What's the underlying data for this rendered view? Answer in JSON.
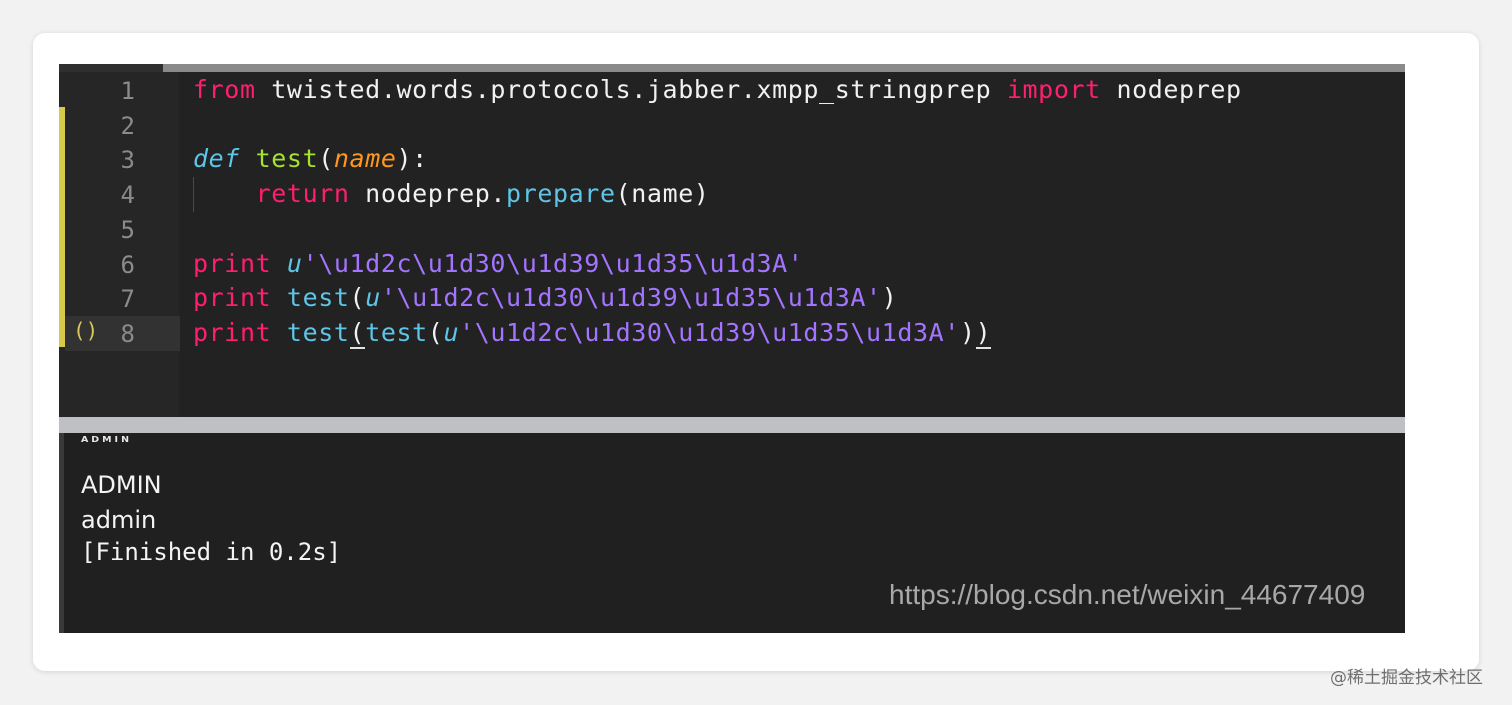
{
  "editor": {
    "lines": [
      {
        "number": "1",
        "tokens": [
          {
            "t": "from",
            "c": "kw"
          },
          {
            "t": " twisted.words.protocols.jabber.xmpp_stringprep ",
            "c": "plain"
          },
          {
            "t": "import",
            "c": "kw"
          },
          {
            "t": " nodeprep",
            "c": "plain"
          }
        ]
      },
      {
        "number": "2",
        "tokens": []
      },
      {
        "number": "3",
        "tokens": [
          {
            "t": "def",
            "c": "def"
          },
          {
            "t": " ",
            "c": "plain"
          },
          {
            "t": "test",
            "c": "fn"
          },
          {
            "t": "(",
            "c": "plain"
          },
          {
            "t": "name",
            "c": "param"
          },
          {
            "t": "):",
            "c": "plain"
          }
        ]
      },
      {
        "number": "4",
        "tokens": [
          {
            "t": "    ",
            "c": "plain"
          },
          {
            "t": "return",
            "c": "kw"
          },
          {
            "t": " nodeprep.",
            "c": "plain"
          },
          {
            "t": "prepare",
            "c": "call"
          },
          {
            "t": "(name)",
            "c": "plain"
          }
        ]
      },
      {
        "number": "5",
        "tokens": []
      },
      {
        "number": "6",
        "tokens": [
          {
            "t": "print",
            "c": "kw"
          },
          {
            "t": " ",
            "c": "plain"
          },
          {
            "t": "u",
            "c": "strprefix"
          },
          {
            "t": "'\\u1d2c\\u1d30\\u1d39\\u1d35\\u1d3A'",
            "c": "str"
          }
        ]
      },
      {
        "number": "7",
        "tokens": [
          {
            "t": "print",
            "c": "kw"
          },
          {
            "t": " ",
            "c": "plain"
          },
          {
            "t": "test",
            "c": "call"
          },
          {
            "t": "(",
            "c": "plain"
          },
          {
            "t": "u",
            "c": "strprefix"
          },
          {
            "t": "'\\u1d2c\\u1d30\\u1d39\\u1d35\\u1d3A'",
            "c": "str"
          },
          {
            "t": ")",
            "c": "plain"
          }
        ]
      },
      {
        "number": "8",
        "tokens": [
          {
            "t": "print",
            "c": "kw"
          },
          {
            "t": " ",
            "c": "plain"
          },
          {
            "t": "test",
            "c": "call"
          },
          {
            "t": "(",
            "c": "plain match"
          },
          {
            "t": "test",
            "c": "call"
          },
          {
            "t": "(",
            "c": "plain"
          },
          {
            "t": "u",
            "c": "strprefix"
          },
          {
            "t": "'\\u1d2c\\u1d30\\u1d39\\u1d35\\u1d3A'",
            "c": "str"
          },
          {
            "t": ")",
            "c": "plain"
          },
          {
            "t": ")",
            "c": "plain match"
          }
        ]
      }
    ],
    "active_line": 8,
    "bracket_marker": "()",
    "colors": {
      "keyword": "#ff1e6f",
      "function": "#a6e22e",
      "storage": "#5ec5e8",
      "parameter": "#fd971f",
      "string": "#a374ff",
      "background": "#222222"
    }
  },
  "output": {
    "line1": "ᴬᴰᴹᴵᴺ",
    "line2": "ADMIN",
    "line3": "admin",
    "line4": "[Finished in 0.2s]",
    "watermark": "https://blog.csdn.net/weixin_44677409"
  },
  "site_mark": "@稀土掘金技术社区"
}
